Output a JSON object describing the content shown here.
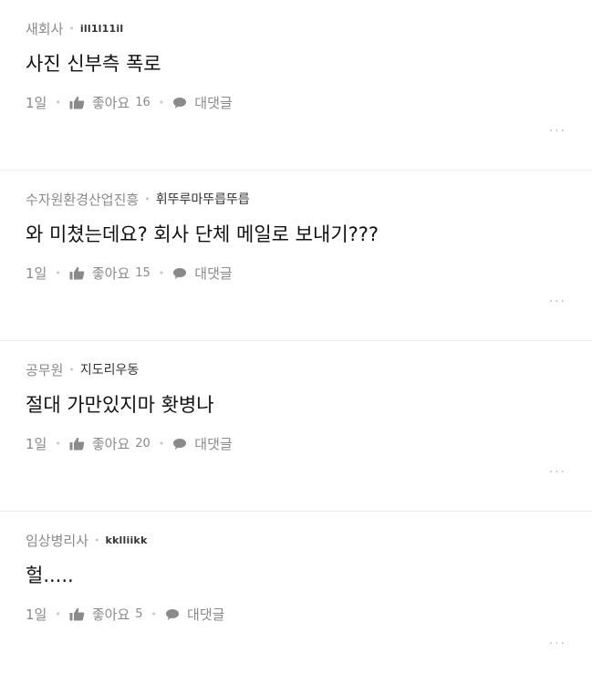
{
  "comments": [
    {
      "company": "새회사",
      "nickname": "ill1l11il",
      "text": "사진 신부측 폭로",
      "time": "1일",
      "like_label": "좋아요",
      "like_count": "16",
      "reply_label": "대댓글",
      "more_label": "..."
    },
    {
      "company": "수자원환경산업진흥",
      "nickname": "휘뚜루마뚜릅뚜릅",
      "text": "와 미쳤는데요? 회사 단체 메일로 보내기???",
      "time": "1일",
      "like_label": "좋아요",
      "like_count": "15",
      "reply_label": "대댓글",
      "more_label": "..."
    },
    {
      "company": "공무원",
      "nickname": "지도리우동",
      "text": "절대 가만있지마 홧병나",
      "time": "1일",
      "like_label": "좋아요",
      "like_count": "20",
      "reply_label": "대댓글",
      "more_label": "..."
    },
    {
      "company": "임상병리사",
      "nickname": "kklliikk",
      "text": "헐.....",
      "time": "1일",
      "like_label": "좋아요",
      "like_count": "5",
      "reply_label": "대댓글",
      "more_label": "..."
    }
  ],
  "icons": {
    "like": "thumbs-up-icon",
    "reply": "speech-bubble-icon",
    "more": "more-options-icon"
  },
  "colors": {
    "meta_gray": "#8a8a8a",
    "text": "#111111",
    "divider": "#ececec"
  }
}
